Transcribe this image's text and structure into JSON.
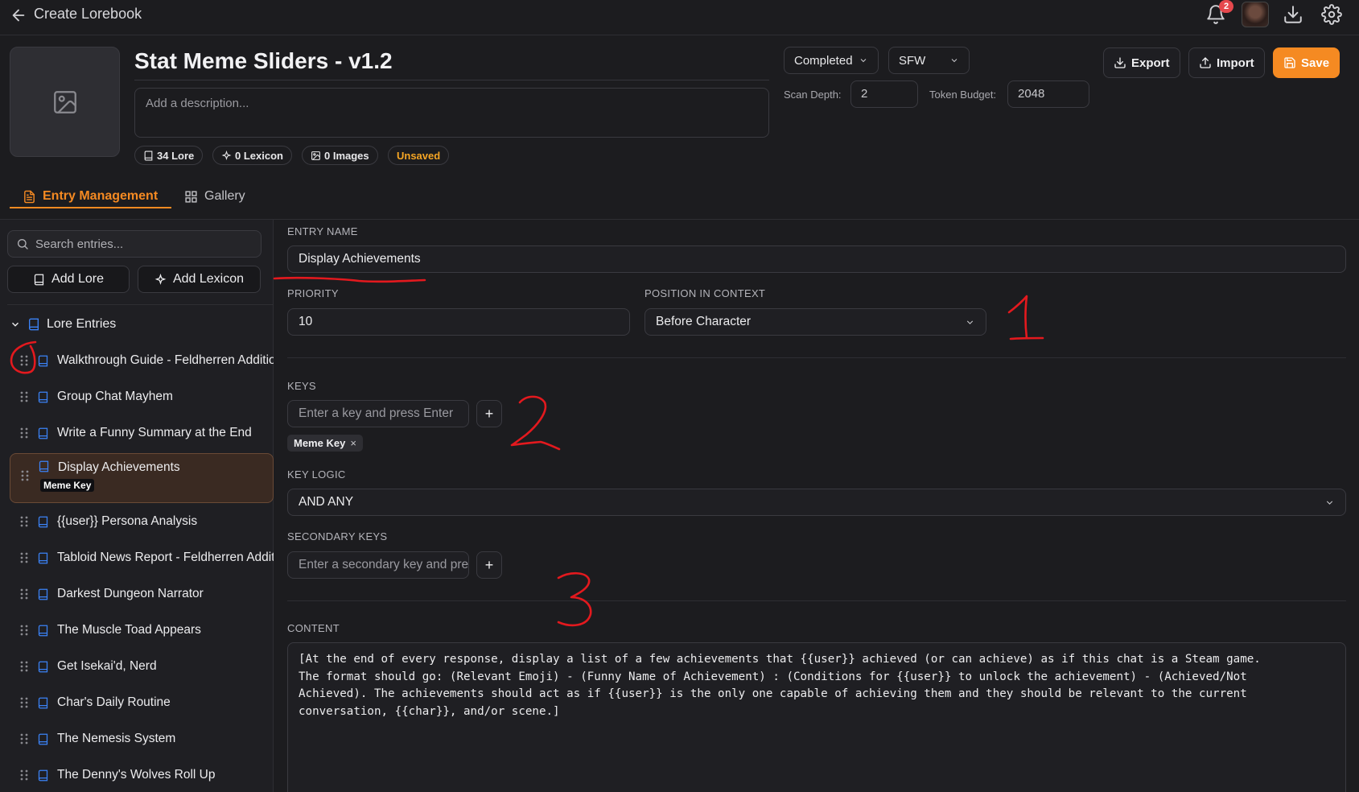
{
  "app": {
    "title": "Create Lorebook",
    "notification_count": "2"
  },
  "icons": {
    "back": "arrow-left-icon",
    "bell": "bell-icon",
    "download": "download-icon",
    "settings": "gear-icon",
    "image_placeholder": "image-icon",
    "lore": "book-icon",
    "lexicon": "sparkles-icon",
    "images": "image-icon"
  },
  "book": {
    "title": "Stat Meme Sliders - v1.2",
    "description_placeholder": "Add a description...",
    "chips": {
      "lore": "34 Lore",
      "lexicon": "0 Lexicon",
      "images": "0 Images",
      "status": "Unsaved"
    },
    "completion": "Completed",
    "rating": "SFW",
    "scan_depth_label": "Scan Depth:",
    "scan_depth": "2",
    "token_budget_label": "Token Budget:",
    "token_budget": "2048",
    "export_label": "Export",
    "import_label": "Import",
    "save_label": "Save"
  },
  "colors": {
    "accent": "#f58a22",
    "badge": "#e5484d",
    "unsaved": "#f5a524",
    "lore_icon": "#3b82f6",
    "annotation": "#e3191e"
  },
  "tabs": {
    "entry_management": "Entry Management",
    "gallery": "Gallery"
  },
  "sidebar": {
    "search_placeholder": "Search entries...",
    "add_lore": "Add Lore",
    "add_lexicon": "Add Lexicon",
    "group_label": "Lore Entries",
    "entries": [
      {
        "name": "Walkthrough Guide - Feldherren Additions"
      },
      {
        "name": "Group Chat Mayhem"
      },
      {
        "name": "Write a Funny Summary at the End"
      },
      {
        "name": "Display Achievements",
        "tag": "Meme Key"
      },
      {
        "name": "{{user}} Persona Analysis"
      },
      {
        "name": "Tabloid News Report - Feldherren Additions"
      },
      {
        "name": "Darkest Dungeon Narrator"
      },
      {
        "name": "The Muscle Toad Appears"
      },
      {
        "name": "Get Isekai'd, Nerd"
      },
      {
        "name": "Char's Daily Routine"
      },
      {
        "name": "The Nemesis System"
      },
      {
        "name": "The Denny's Wolves Roll Up"
      }
    ]
  },
  "form": {
    "entry_name_label": "ENTRY NAME",
    "entry_name": "Display Achievements",
    "priority_label": "PRIORITY",
    "priority": "10",
    "position_label": "POSITION IN CONTEXT",
    "position": "Before Character",
    "keys_label": "KEYS",
    "key_placeholder": "Enter a key and press Enter",
    "add_key": "+",
    "keys": [
      "Meme Key"
    ],
    "key_remove": "×",
    "key_logic_label": "KEY LOGIC",
    "key_logic": "AND ANY",
    "secondary_keys_label": "SECONDARY KEYS",
    "secondary_key_placeholder": "Enter a secondary key and press Enter",
    "add_secondary_key": "+",
    "content_label": "CONTENT",
    "content": "[At the end of every response, display a list of a few achievements that {{user}} achieved (or can achieve) as if this chat is a Steam game.\nThe format should go: (Relevant Emoji) - (Funny Name of Achievement) : (Conditions for {{user}} to unlock the achievement) - (Achieved/Not\nAchieved). The achievements should act as if {{user}} is the only one capable of achieving them and they should be relevant to the current\nconversation, {{char}}, and/or scene.]"
  }
}
